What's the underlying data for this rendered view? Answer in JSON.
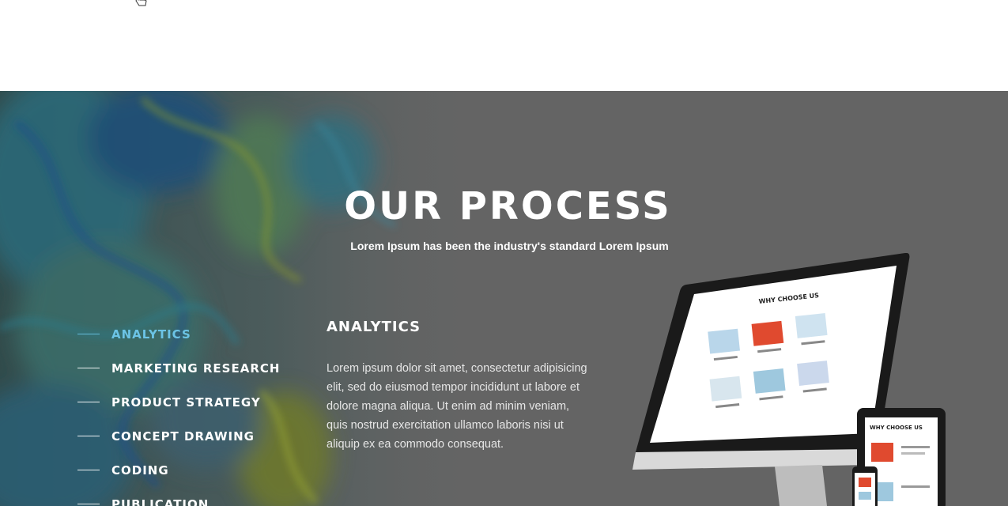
{
  "section": {
    "title": "OUR PROCESS",
    "subtitle": "Lorem Ipsum has been the industry's standard Lorem Ipsum"
  },
  "tabs": [
    {
      "label": "ANALYTICS",
      "active": true
    },
    {
      "label": "MARKETING RESEARCH",
      "active": false
    },
    {
      "label": "PRODUCT STRATEGY",
      "active": false
    },
    {
      "label": "CONCEPT DRAWING",
      "active": false
    },
    {
      "label": "CODING",
      "active": false
    },
    {
      "label": "PUBLICATION",
      "active": false
    }
  ],
  "detail": {
    "title": "ANALYTICS",
    "body": "Lorem ipsum dolor sit amet, consectetur adipisicing elit, sed do eiusmod tempor incididunt ut labore et dolore magna aliqua. Ut enim ad minim veniam, quis nostrud exercitation ullamco laboris nisi ut aliquip ex ea commodo consequat."
  },
  "devices": {
    "monitor_heading": "WHY CHOOSE US",
    "tablet_heading": "WHY CHOOSE US"
  },
  "colors": {
    "background": "#646464",
    "accent": "#6cc4e6",
    "text": "#ffffff"
  }
}
